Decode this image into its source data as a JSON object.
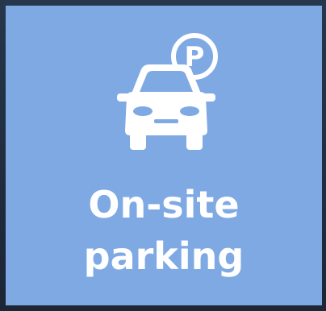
{
  "tile": {
    "line1": "On-site",
    "line2": "parking",
    "icon": "car-parking-icon",
    "background": "#7fa9e3",
    "foreground": "#ffffff"
  }
}
